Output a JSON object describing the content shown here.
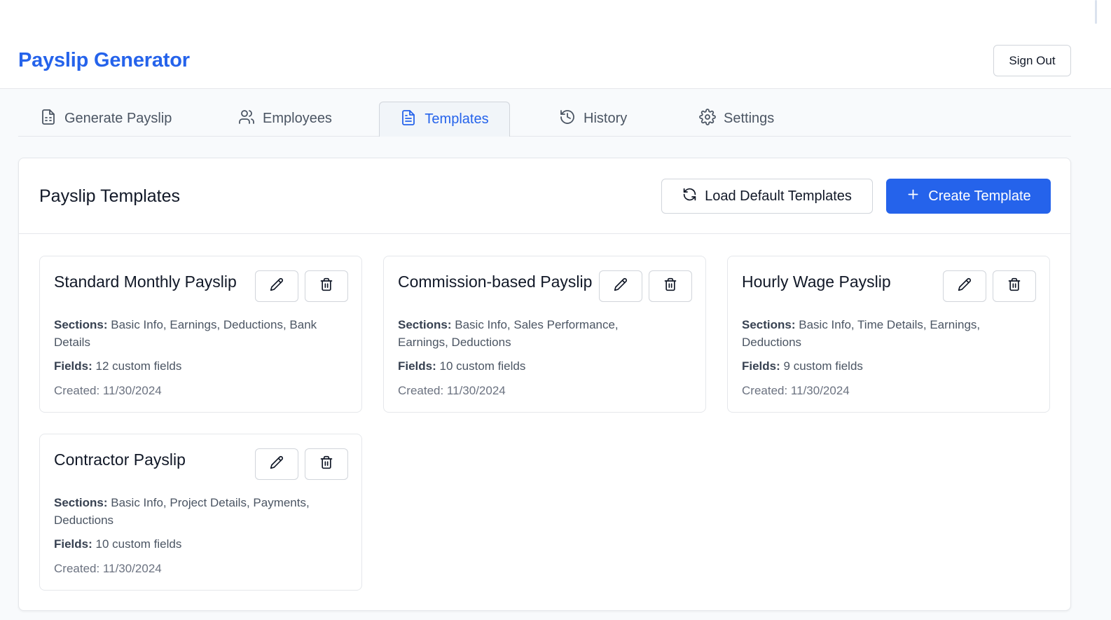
{
  "app": {
    "title": "Payslip Generator",
    "sign_out": "Sign Out"
  },
  "tabs": [
    {
      "label": "Generate Payslip",
      "icon": "file-text-icon"
    },
    {
      "label": "Employees",
      "icon": "users-icon"
    },
    {
      "label": "Templates",
      "icon": "file-icon",
      "active": true
    },
    {
      "label": "History",
      "icon": "history-icon"
    },
    {
      "label": "Settings",
      "icon": "gear-icon"
    }
  ],
  "panel": {
    "title": "Payslip Templates",
    "load_defaults": "Load Default Templates",
    "create": "Create Template"
  },
  "labels": {
    "sections": "Sections:",
    "fields": "Fields:"
  },
  "templates": [
    {
      "name": "Standard Monthly Payslip",
      "sections": "Basic Info, Earnings, Deductions, Bank Details",
      "fields": "12 custom fields",
      "created": "Created: 11/30/2024"
    },
    {
      "name": "Commission-based Payslip",
      "sections": "Basic Info, Sales Performance, Earnings, Deductions",
      "fields": "10 custom fields",
      "created": "Created: 11/30/2024"
    },
    {
      "name": "Hourly Wage Payslip",
      "sections": "Basic Info, Time Details, Earnings, Deductions",
      "fields": "9 custom fields",
      "created": "Created: 11/30/2024"
    },
    {
      "name": "Contractor Payslip",
      "sections": "Basic Info, Project Details, Payments, Deductions",
      "fields": "10 custom fields",
      "created": "Created: 11/30/2024"
    }
  ],
  "colors": {
    "accent": "#2563eb",
    "border": "#e5e7eb",
    "background": "#f8fafc"
  }
}
